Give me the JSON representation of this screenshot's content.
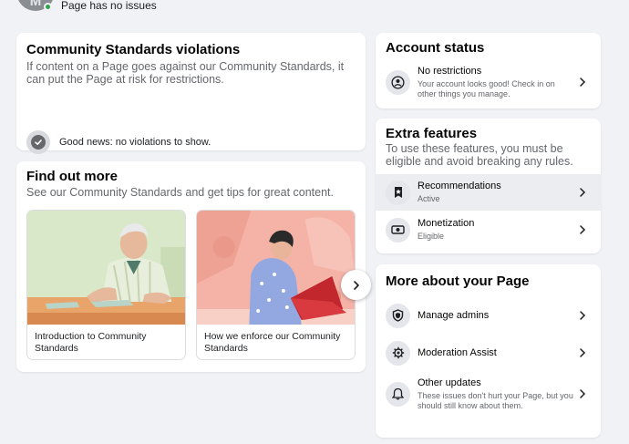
{
  "header": {
    "avatar_initial": "M",
    "page_status": "Page has no issues"
  },
  "violations": {
    "title": "Community Standards violations",
    "description": "If content on a Page goes against our Community Standards, it can put the Page at risk for restrictions.",
    "status": "Good news: no violations to show."
  },
  "find_out_more": {
    "title": "Find out more",
    "subtitle": "See our Community Standards and get tips for great content.",
    "articles": [
      {
        "caption": "Introduction to Community Standards"
      },
      {
        "caption": "How we enforce our Community Standards"
      }
    ]
  },
  "account_status": {
    "title": "Account status",
    "item": {
      "title": "No restrictions",
      "desc": "Your account looks good! Check in on other things you manage."
    }
  },
  "extra_features": {
    "title": "Extra features",
    "subtitle": "To use these features, you must be eligible and avoid breaking any rules.",
    "items": [
      {
        "title": "Recommendations",
        "status": "Active"
      },
      {
        "title": "Monetization",
        "status": "Eligible"
      }
    ]
  },
  "more_about": {
    "title": "More about your Page",
    "items": [
      {
        "title": "Manage admins"
      },
      {
        "title": "Moderation Assist"
      },
      {
        "title": "Other updates",
        "desc": "These issues don't hurt your Page, but you should still know about them."
      }
    ]
  }
}
